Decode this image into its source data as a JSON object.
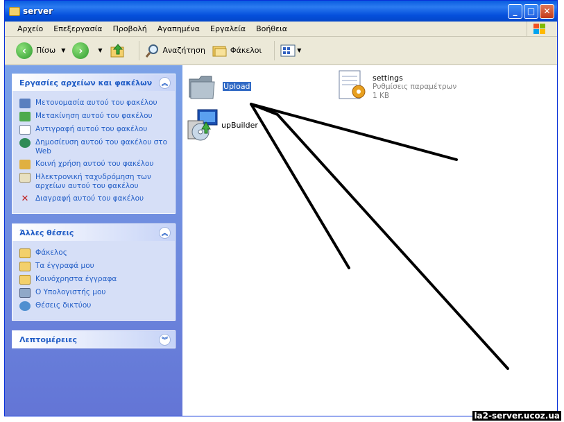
{
  "window": {
    "title": "server"
  },
  "menu": [
    "Αρχείο",
    "Επεξεργασία",
    "Προβολή",
    "Αγαπημένα",
    "Εργαλεία",
    "Βοήθεια"
  ],
  "toolbar": {
    "back": "Πίσω",
    "search": "Αναζήτηση",
    "folders": "Φάκελοι"
  },
  "tasks_panel": {
    "title": "Εργασίες αρχείων και φακέλων",
    "items": [
      "Μετονομασία αυτού του φακέλου",
      "Μετακίνηση αυτού του φακέλου",
      "Αντιγραφή αυτού του φακέλου",
      "Δημοσίευση αυτού του φακέλου στο Web",
      "Κοινή χρήση αυτού του φακέλου",
      "Ηλεκτρονική ταχυδρόμηση των αρχείων αυτού του φακέλου",
      "Διαγραφή αυτού του φακέλου"
    ]
  },
  "places_panel": {
    "title": "Άλλες θέσεις",
    "items": [
      "Φάκελος",
      "Τα έγγραφά μου",
      "Κοινόχρηστα έγγραφα",
      "Ο Υπολογιστής μου",
      "Θέσεις δικτύου"
    ]
  },
  "details_panel": {
    "title": "Λεπτομέρειες"
  },
  "files": {
    "upload": {
      "name": "Upload"
    },
    "settings": {
      "name": "settings",
      "type": "Ρυθμίσεις παραμέτρων",
      "size": "1 KB"
    },
    "upbuilder": {
      "name": "upBuilder"
    }
  },
  "watermark": "la2-server.ucoz.ua"
}
